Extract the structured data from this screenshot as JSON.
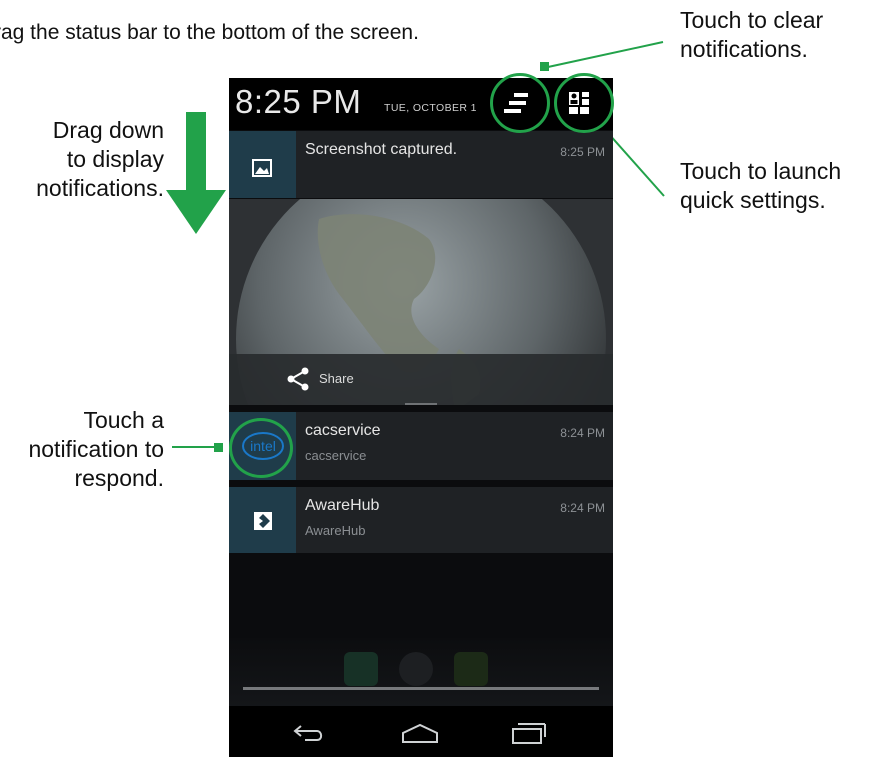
{
  "heading": "",
  "instruction": "rag the status bar to the bottom of the screen.",
  "callouts": {
    "clear": [
      "Touch to clear",
      "notifications."
    ],
    "quick": [
      "Touch to launch",
      "quick settings."
    ],
    "drag": [
      "Drag down",
      "to display",
      "notifications."
    ],
    "touch": [
      "Touch a",
      "notification to",
      "respond."
    ]
  },
  "statusbar": {
    "time": "8:25 PM",
    "date": "TUE, OCTOBER 1",
    "clear_icon": "clear-notifications-icon",
    "settings_icon": "quick-settings-icon"
  },
  "notifications": [
    {
      "title": "Screenshot captured.",
      "subtitle": "",
      "time": "8:25 PM",
      "icon": "image-icon"
    },
    {
      "title": "cacservice",
      "subtitle": "cacservice",
      "time": "8:24 PM",
      "icon": "intel-logo"
    },
    {
      "title": "AwareHub",
      "subtitle": "AwareHub",
      "time": "8:24 PM",
      "icon": "awarehub-icon"
    }
  ],
  "share_label": "Share",
  "colors": {
    "accent_green": "#22a24a",
    "notification_bg": "#1f2225",
    "icon_bg": "#1f3c4a"
  }
}
